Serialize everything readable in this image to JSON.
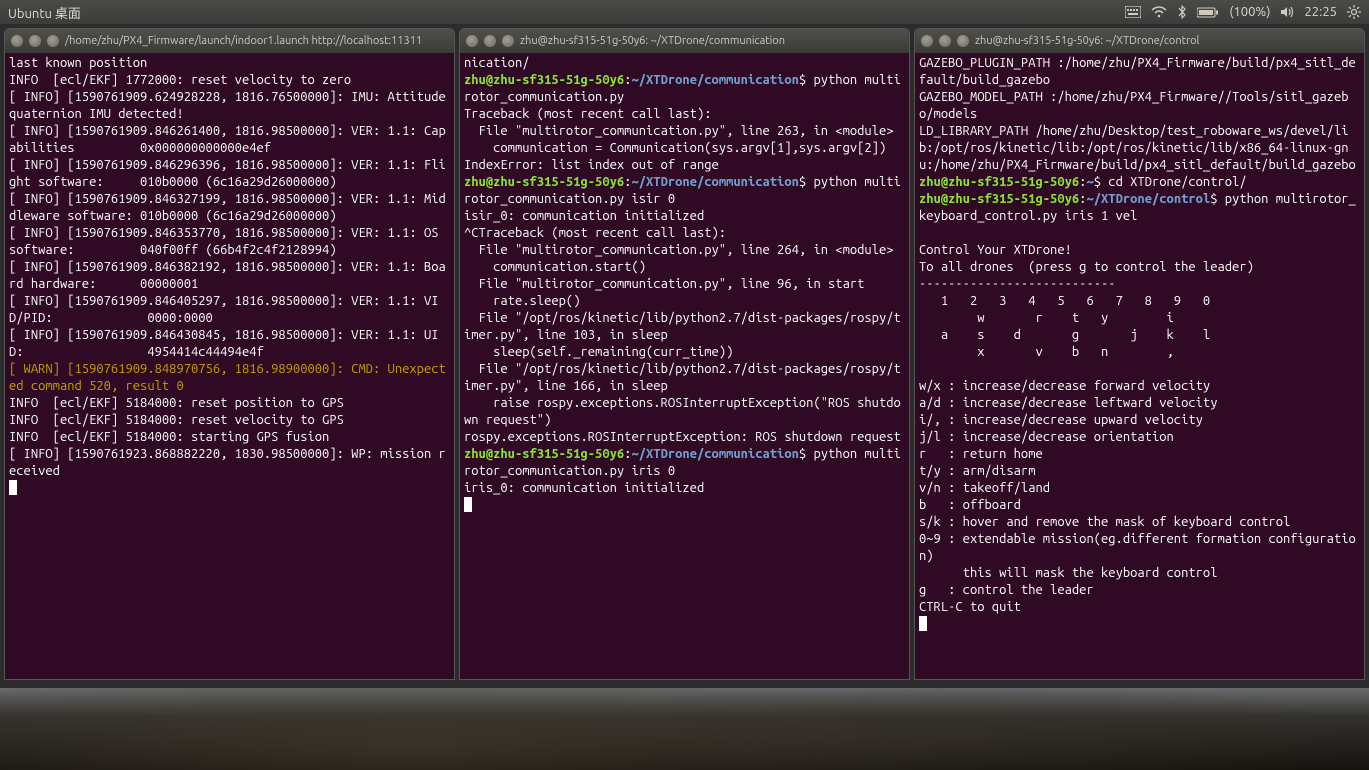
{
  "menubar": {
    "left": "Ubuntu 桌面",
    "battery": "(100%)",
    "time": "22:25"
  },
  "terminals": [
    {
      "title": "/home/zhu/PX4_Firmware/launch/indoor1.launch http://localhost:11311",
      "lines": [
        {
          "t": "last known position"
        },
        {
          "t": "INFO  [ecl/EKF] 1772000: reset velocity to zero"
        },
        {
          "t": "[ INFO] [1590761909.624928228, 1816.76500000]: IMU: Attitude quaternion IMU detected!"
        },
        {
          "t": "[ INFO] [1590761909.846261400, 1816.98500000]: VER: 1.1: Capabilities         0x000000000000e4ef"
        },
        {
          "t": "[ INFO] [1590761909.846296396, 1816.98500000]: VER: 1.1: Flight software:     010b0000 (6c16a29d26000000)"
        },
        {
          "t": "[ INFO] [1590761909.846327199, 1816.98500000]: VER: 1.1: Middleware software: 010b0000 (6c16a29d26000000)"
        },
        {
          "t": "[ INFO] [1590761909.846353770, 1816.98500000]: VER: 1.1: OS software:         040f00ff (66b4f2c4f2128994)"
        },
        {
          "t": "[ INFO] [1590761909.846382192, 1816.98500000]: VER: 1.1: Board hardware:      00000001"
        },
        {
          "t": "[ INFO] [1590761909.846405297, 1816.98500000]: VER: 1.1: VID/PID:             0000:0000"
        },
        {
          "t": "[ INFO] [1590761909.846430845, 1816.98500000]: VER: 1.1: UID:                 4954414c44494e4f"
        },
        {
          "cls": "c-warn",
          "t": "[ WARN] [1590761909.848970756, 1816.98900000]: CMD: Unexpected command 520, result 0"
        },
        {
          "t": "INFO  [ecl/EKF] 5184000: reset position to GPS"
        },
        {
          "t": "INFO  [ecl/EKF] 5184000: reset velocity to GPS"
        },
        {
          "t": "INFO  [ecl/EKF] 5184000: starting GPS fusion"
        },
        {
          "t": "[ INFO] [1590761923.868882220, 1830.98500000]: WP: mission received"
        }
      ],
      "cursor": true
    },
    {
      "title": "zhu@zhu-sf315-51g-50y6: ~/XTDrone/communication",
      "content": [
        {
          "type": "plain",
          "t": "nication/\n"
        },
        {
          "type": "prompt",
          "user": "zhu@zhu-sf315-51g-50y6",
          "path": "~/XTDrone/communication",
          "cmd": "python multirotor_communication.py"
        },
        {
          "type": "plain",
          "t": "Traceback (most recent call last):\n  File \"multirotor_communication.py\", line 263, in <module>\n    communication = Communication(sys.argv[1],sys.argv[2])\nIndexError: list index out of range\n"
        },
        {
          "type": "prompt",
          "user": "zhu@zhu-sf315-51g-50y6",
          "path": "~/XTDrone/communication",
          "cmd": "python multirotor_communication.py isir 0"
        },
        {
          "type": "plain",
          "t": "isir_0: communication initialized\n^CTraceback (most recent call last):\n  File \"multirotor_communication.py\", line 264, in <module>\n    communication.start()\n  File \"multirotor_communication.py\", line 96, in start\n    rate.sleep()\n  File \"/opt/ros/kinetic/lib/python2.7/dist-packages/rospy/timer.py\", line 103, in sleep\n    sleep(self._remaining(curr_time))\n  File \"/opt/ros/kinetic/lib/python2.7/dist-packages/rospy/timer.py\", line 166, in sleep\n    raise rospy.exceptions.ROSInterruptException(\"ROS shutdown request\")\nrospy.exceptions.ROSInterruptException: ROS shutdown request\n"
        },
        {
          "type": "prompt",
          "user": "zhu@zhu-sf315-51g-50y6",
          "path": "~/XTDrone/communication",
          "cmd": "python multirotor_communication.py iris 0"
        },
        {
          "type": "plain",
          "t": "iris_0: communication initialized\n"
        }
      ],
      "cursor": true
    },
    {
      "title": "zhu@zhu-sf315-51g-50y6: ~/XTDrone/control",
      "content": [
        {
          "type": "plain",
          "t": "GAZEBO_PLUGIN_PATH :/home/zhu/PX4_Firmware/build/px4_sitl_default/build_gazebo\nGAZEBO_MODEL_PATH :/home/zhu/PX4_Firmware//Tools/sitl_gazebo/models\nLD_LIBRARY_PATH /home/zhu/Desktop/test_roboware_ws/devel/lib:/opt/ros/kinetic/lib:/opt/ros/kinetic/lib/x86_64-linux-gnu:/home/zhu/PX4_Firmware/build/px4_sitl_default/build_gazebo\n"
        },
        {
          "type": "prompt",
          "user": "zhu@zhu-sf315-51g-50y6",
          "path": "~",
          "cmd": "cd XTDrone/control/"
        },
        {
          "type": "prompt",
          "user": "zhu@zhu-sf315-51g-50y6",
          "path": "~/XTDrone/control",
          "cmd": "python multirotor_keyboard_control.py iris 1 vel"
        },
        {
          "type": "plain",
          "t": "\nControl Your XTDrone!\nTo all drones  (press g to control the leader)\n---------------------------\n   1   2   3   4   5   6   7   8   9   0\n        w       r    t   y        i\n   a    s    d       g       j    k    l\n        x       v    b   n        ,\n\nw/x : increase/decrease forward velocity\na/d : increase/decrease leftward velocity\ni/, : increase/decrease upward velocity\nj/l : increase/decrease orientation\nr   : return home\nt/y : arm/disarm\nv/n : takeoff/land\nb   : offboard\ns/k : hover and remove the mask of keyboard control\n0~9 : extendable mission(eg.different formation configuration)\n      this will mask the keyboard control\ng   : control the leader\nCTRL-C to quit\n"
        }
      ],
      "cursor": true
    }
  ]
}
